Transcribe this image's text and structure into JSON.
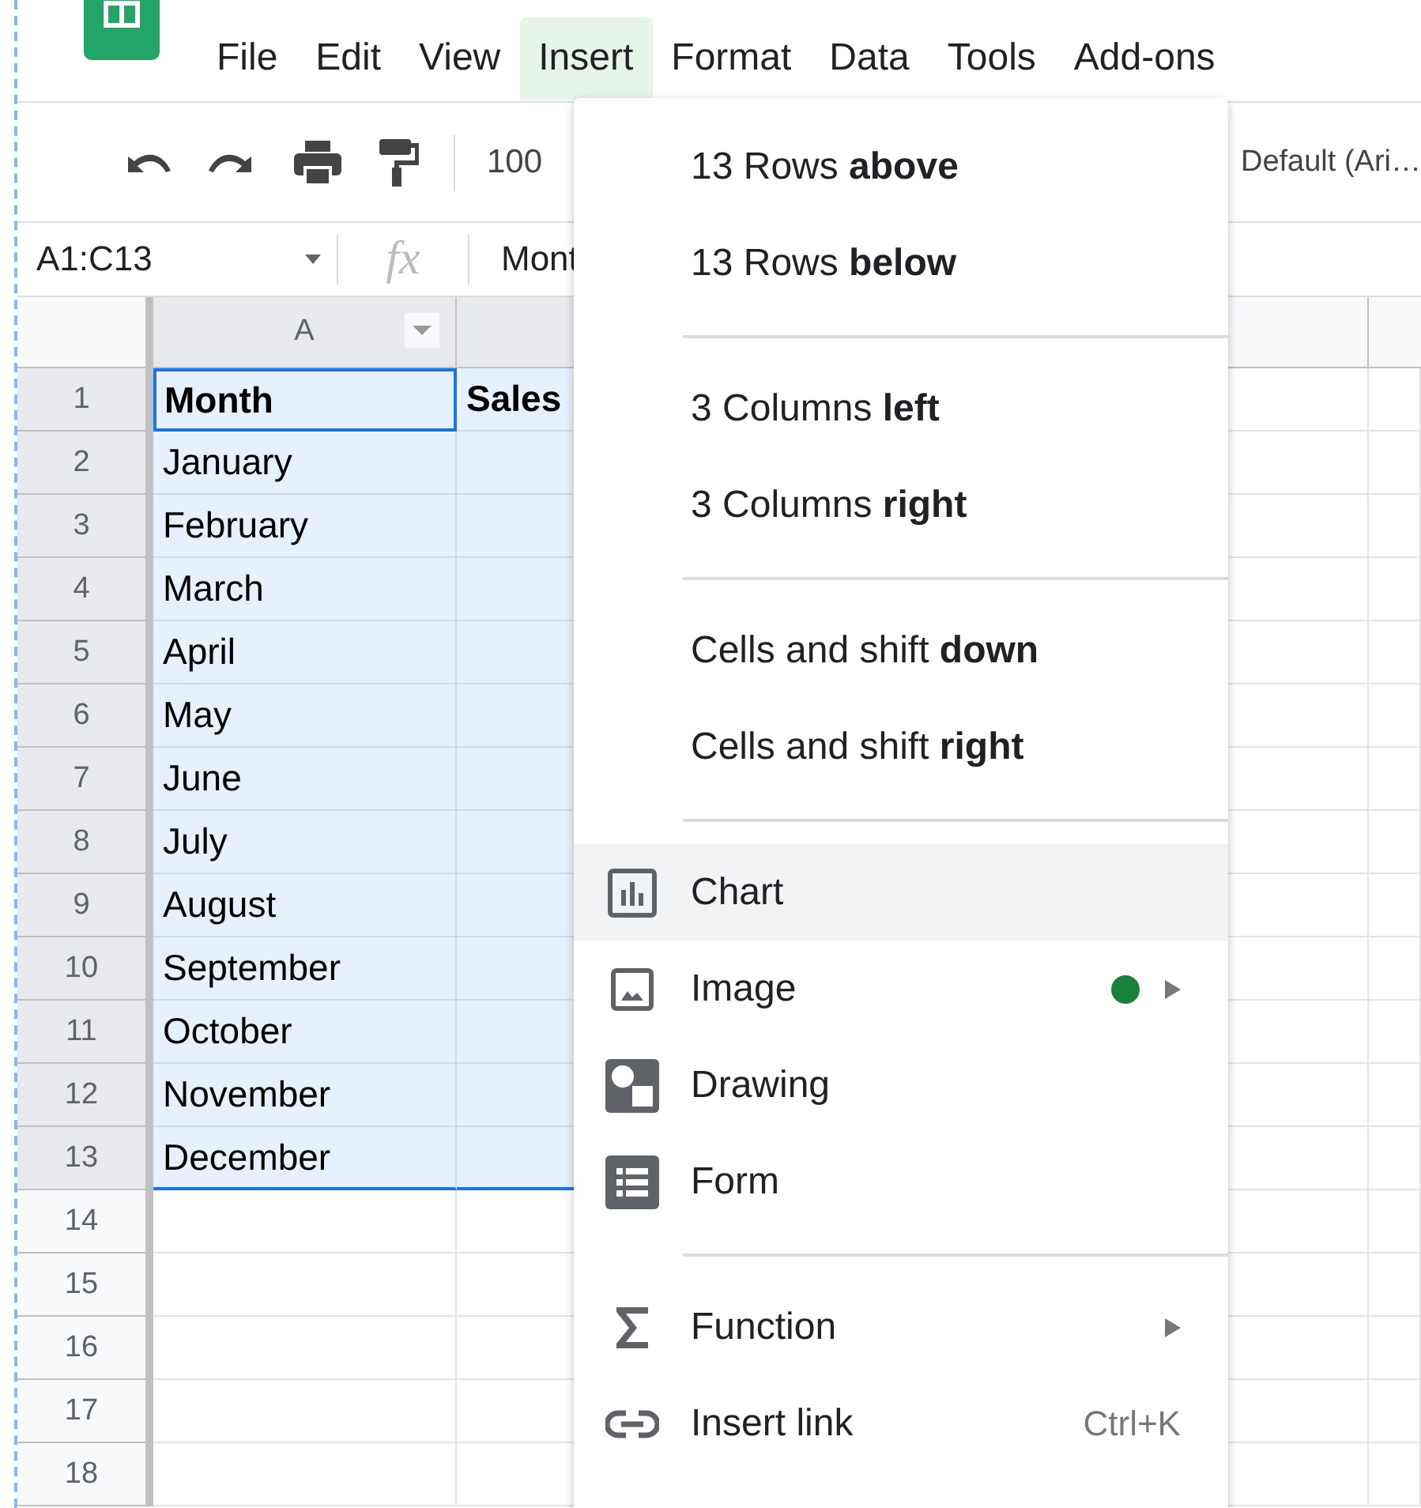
{
  "menubar": {
    "items": [
      {
        "label": "File",
        "selected": false
      },
      {
        "label": "Edit",
        "selected": false
      },
      {
        "label": "View",
        "selected": false
      },
      {
        "label": "Insert",
        "selected": true
      },
      {
        "label": "Format",
        "selected": false
      },
      {
        "label": "Data",
        "selected": false
      },
      {
        "label": "Tools",
        "selected": false
      },
      {
        "label": "Add-ons",
        "selected": false
      }
    ]
  },
  "toolbar": {
    "zoom": "100",
    "font": "Default (Ari…"
  },
  "formula_bar": {
    "name_box": "A1:C13",
    "fx": "fx",
    "value": "Mont"
  },
  "sheet": {
    "header_row": true,
    "columns": [
      {
        "label": "A",
        "filter": true
      }
    ],
    "rows": [
      {
        "number": "1",
        "cells": [
          "Month",
          "Sales"
        ],
        "selected": true,
        "active": true
      },
      {
        "number": "2",
        "cells": [
          "January",
          ""
        ],
        "selected": true,
        "active": false
      },
      {
        "number": "3",
        "cells": [
          "February",
          ""
        ],
        "selected": true,
        "active": false
      },
      {
        "number": "4",
        "cells": [
          "March",
          ""
        ],
        "selected": true,
        "active": false
      },
      {
        "number": "5",
        "cells": [
          "April",
          ""
        ],
        "selected": true,
        "active": false
      },
      {
        "number": "6",
        "cells": [
          "May",
          ""
        ],
        "selected": true,
        "active": false
      },
      {
        "number": "7",
        "cells": [
          "June",
          ""
        ],
        "selected": true,
        "active": false
      },
      {
        "number": "8",
        "cells": [
          "July",
          ""
        ],
        "selected": true,
        "active": false
      },
      {
        "number": "9",
        "cells": [
          "August",
          ""
        ],
        "selected": true,
        "active": false
      },
      {
        "number": "10",
        "cells": [
          "September",
          ""
        ],
        "selected": true,
        "active": false
      },
      {
        "number": "11",
        "cells": [
          "October",
          ""
        ],
        "selected": true,
        "active": false
      },
      {
        "number": "12",
        "cells": [
          "November",
          ""
        ],
        "selected": true,
        "active": false
      },
      {
        "number": "13",
        "cells": [
          "December",
          ""
        ],
        "selected": true,
        "active": false
      },
      {
        "number": "14",
        "cells": [
          "",
          ""
        ],
        "selected": false,
        "active": false
      },
      {
        "number": "15",
        "cells": [
          "",
          ""
        ],
        "selected": false,
        "active": false
      },
      {
        "number": "16",
        "cells": [
          "",
          ""
        ],
        "selected": false,
        "active": false
      },
      {
        "number": "17",
        "cells": [
          "",
          ""
        ],
        "selected": false,
        "active": false
      },
      {
        "number": "18",
        "cells": [
          "",
          ""
        ],
        "selected": false,
        "active": false
      }
    ]
  },
  "insert_menu": {
    "items": [
      {
        "kind": "text",
        "label": "13 Rows **above**",
        "highlighted": false
      },
      {
        "kind": "text",
        "label": "13 Rows **below**",
        "highlighted": false
      },
      {
        "kind": "divider"
      },
      {
        "kind": "text",
        "label": "3 Columns **left**",
        "highlighted": false
      },
      {
        "kind": "text",
        "label": "3 Columns **right**",
        "highlighted": false
      },
      {
        "kind": "divider"
      },
      {
        "kind": "text",
        "label": "Cells and shift **down**",
        "highlighted": false
      },
      {
        "kind": "text",
        "label": "Cells and shift **right**",
        "highlighted": false
      },
      {
        "kind": "divider"
      },
      {
        "kind": "chart",
        "label": "Chart",
        "highlighted": true
      },
      {
        "kind": "image",
        "label": "Image",
        "highlighted": false,
        "color": "#188038",
        "submenu": true
      },
      {
        "kind": "drawing",
        "label": "Drawing",
        "highlighted": false
      },
      {
        "kind": "form",
        "label": "Form",
        "highlighted": false
      },
      {
        "kind": "divider"
      },
      {
        "kind": "function",
        "label": "Function",
        "highlighted": false,
        "submenu": true
      },
      {
        "kind": "link",
        "label": "Insert link",
        "highlighted": false,
        "shortcut": "Ctrl+K"
      }
    ]
  }
}
